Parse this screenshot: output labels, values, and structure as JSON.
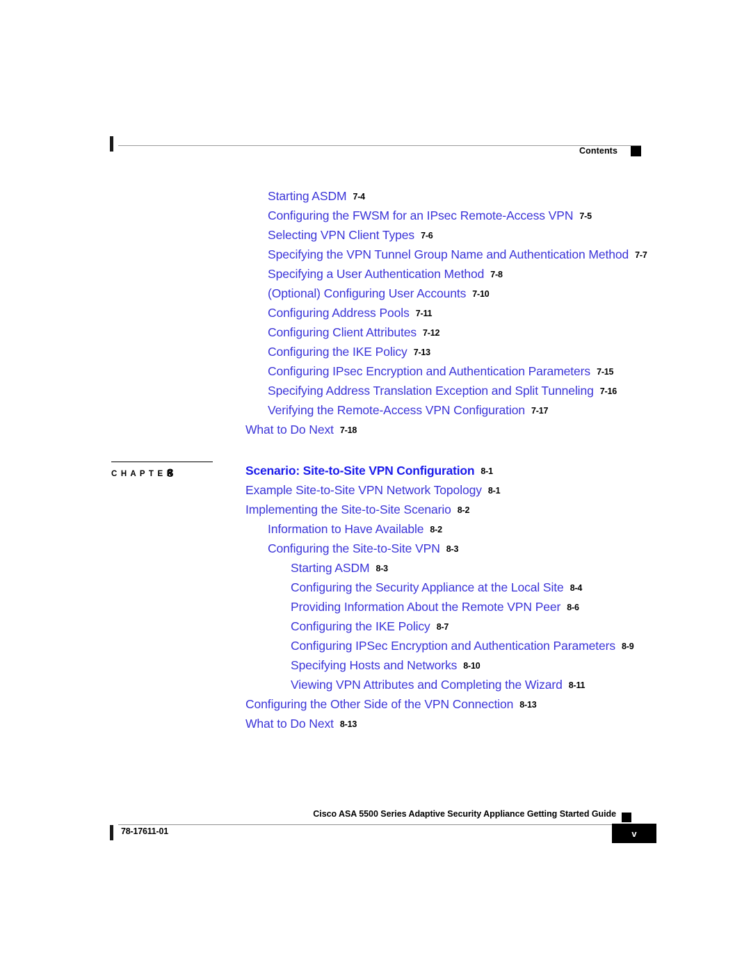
{
  "header": {
    "label": "Contents"
  },
  "toc": {
    "entries": [
      {
        "level": 3,
        "label": "Starting ASDM",
        "page": "7-4"
      },
      {
        "level": 3,
        "label": "Configuring the FWSM for an IPsec Remote-Access VPN",
        "page": "7-5"
      },
      {
        "level": 3,
        "label": "Selecting VPN Client Types",
        "page": "7-6"
      },
      {
        "level": 3,
        "label": "Specifying the VPN Tunnel Group Name and Authentication Method",
        "page": "7-7"
      },
      {
        "level": 3,
        "label": "Specifying a User Authentication Method",
        "page": "7-8"
      },
      {
        "level": 3,
        "label": "(Optional) Configuring User Accounts",
        "page": "7-10"
      },
      {
        "level": 3,
        "label": "Configuring Address Pools",
        "page": "7-11"
      },
      {
        "level": 3,
        "label": "Configuring Client Attributes",
        "page": "7-12"
      },
      {
        "level": 3,
        "label": "Configuring the IKE Policy",
        "page": "7-13"
      },
      {
        "level": 3,
        "label": "Configuring IPsec Encryption and Authentication Parameters",
        "page": "7-15"
      },
      {
        "level": 3,
        "label": "Specifying Address Translation Exception and Split Tunneling",
        "page": "7-16"
      },
      {
        "level": 3,
        "label": "Verifying the Remote-Access VPN Configuration",
        "page": "7-17"
      },
      {
        "level": 2,
        "label": "What to Do Next",
        "page": "7-18"
      },
      {
        "level": 1,
        "label": "Scenario: Site-to-Site VPN Configuration",
        "page": "8-1",
        "chapter_head": true
      },
      {
        "level": 2,
        "label": "Example Site-to-Site VPN Network Topology",
        "page": "8-1"
      },
      {
        "level": 2,
        "label": "Implementing the Site-to-Site Scenario",
        "page": "8-2"
      },
      {
        "level": 3,
        "label": "Information to Have Available",
        "page": "8-2"
      },
      {
        "level": 3,
        "label": "Configuring the Site-to-Site VPN",
        "page": "8-3"
      },
      {
        "level": 4,
        "label": "Starting ASDM",
        "page": "8-3"
      },
      {
        "level": 4,
        "label": "Configuring the Security Appliance at the Local Site",
        "page": "8-4"
      },
      {
        "level": 4,
        "label": "Providing Information About the Remote VPN Peer",
        "page": "8-6"
      },
      {
        "level": 4,
        "label": "Configuring the IKE Policy",
        "page": "8-7"
      },
      {
        "level": 4,
        "label": "Configuring IPSec Encryption and Authentication Parameters",
        "page": "8-9"
      },
      {
        "level": 4,
        "label": "Specifying Hosts and Networks",
        "page": "8-10"
      },
      {
        "level": 4,
        "label": "Viewing VPN Attributes and Completing the Wizard",
        "page": "8-11"
      },
      {
        "level": 2,
        "label": "Configuring the Other Side of the VPN Connection",
        "page": "8-13"
      },
      {
        "level": 2,
        "label": "What to Do Next",
        "page": "8-13"
      }
    ]
  },
  "chapter_tag": {
    "word": "C H A P T E R",
    "number": "8"
  },
  "footer": {
    "title": "Cisco ASA 5500 Series Adaptive Security Appliance Getting Started Guide",
    "doc_number": "78-17611-01",
    "page_number": "v"
  },
  "colors": {
    "link_blue": "#3b34d8",
    "heading_blue": "#1b1bea",
    "text_black": "#000000",
    "rule_gray": "#9a9a9a"
  }
}
